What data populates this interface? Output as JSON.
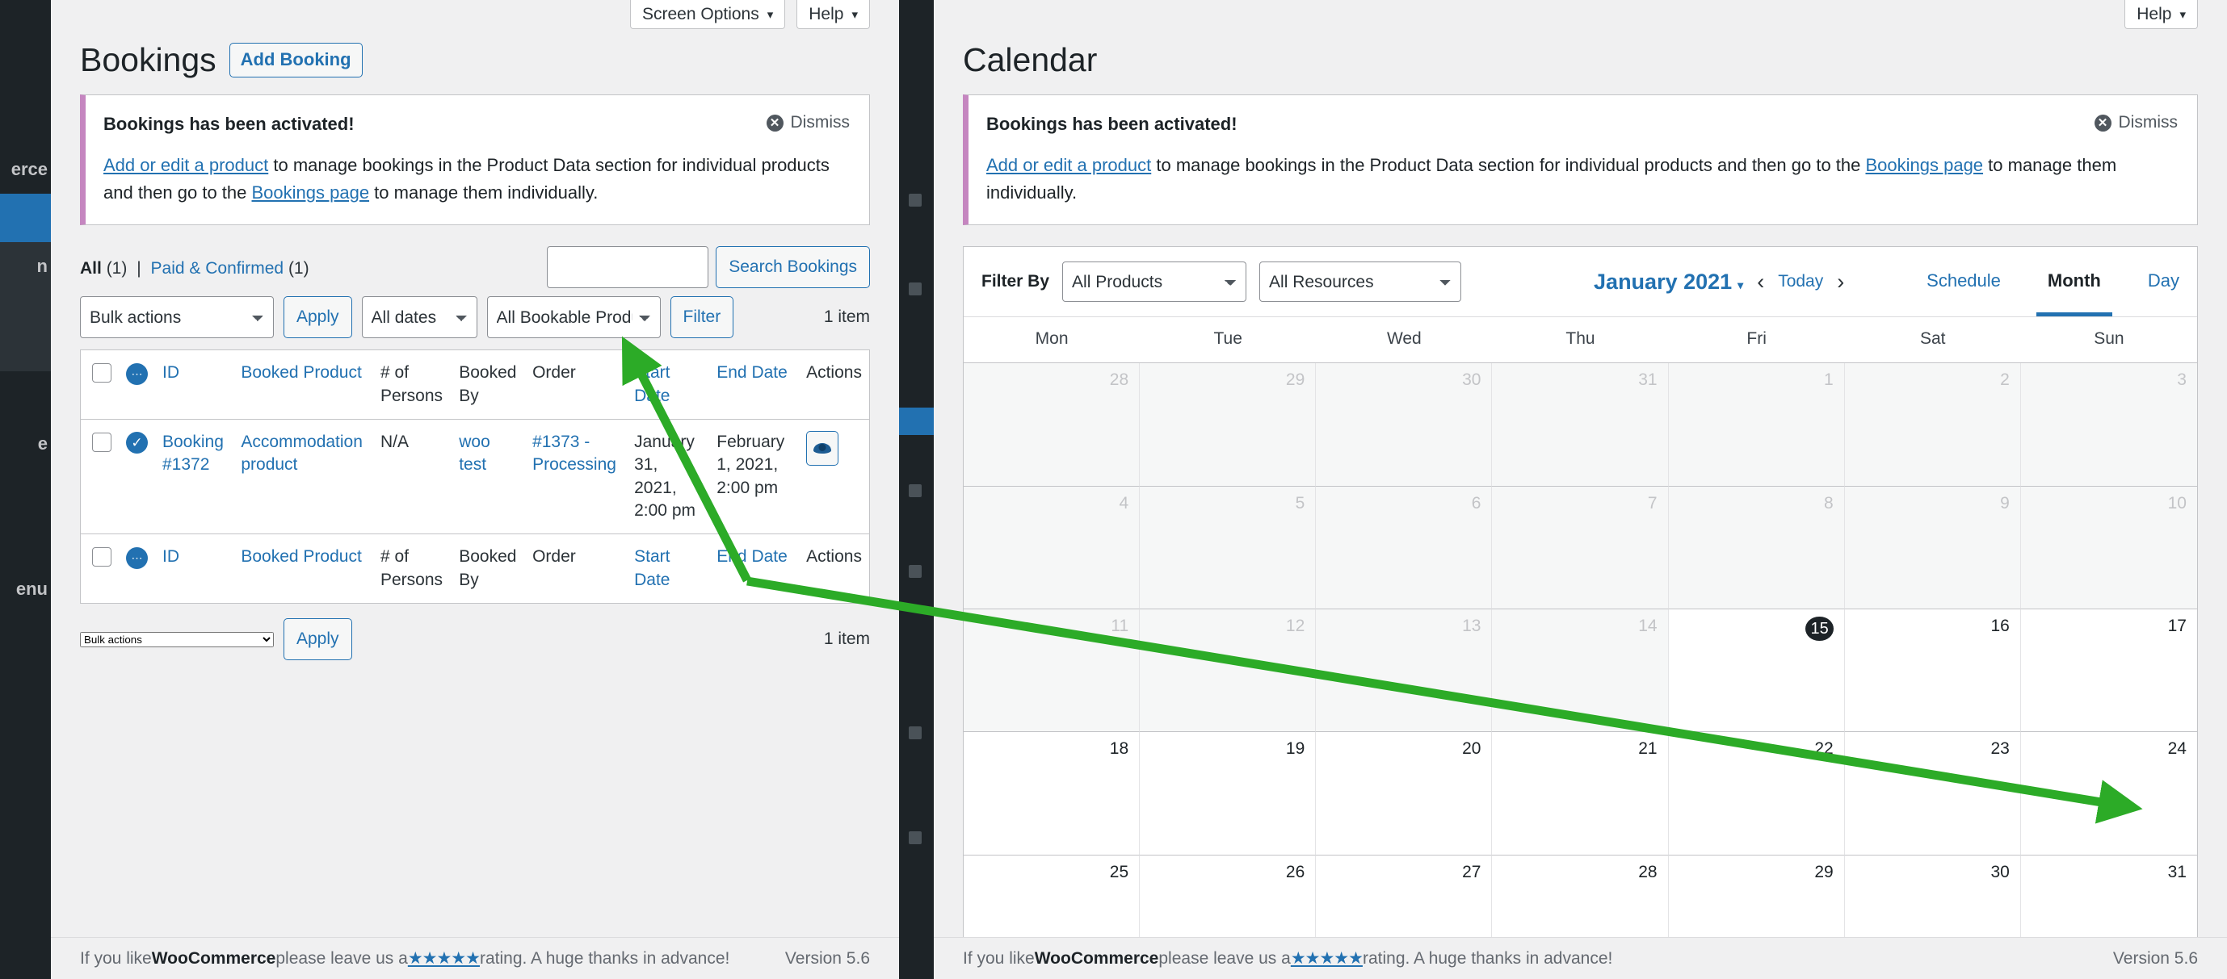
{
  "sidebar": {
    "items": [
      {
        "label": "erce",
        "state": "normal"
      },
      {
        "label": "",
        "state": "current"
      },
      {
        "label": "n",
        "state": "submenu"
      },
      {
        "label": "e",
        "state": "normal"
      },
      {
        "label": "enu",
        "state": "normal"
      }
    ]
  },
  "bookings_page": {
    "screen_meta": [
      {
        "label": "Screen Options",
        "caret": "▾"
      },
      {
        "label": "Help",
        "caret": "▾"
      }
    ],
    "title": "Bookings",
    "add_button": "Add Booking",
    "notice": {
      "title": "Bookings has been activated!",
      "link1": "Add or edit a product",
      "text_mid": " to manage bookings in the Product Data section for individual products and then go to the ",
      "link2": "Bookings page",
      "text_end": " to manage them individually.",
      "dismiss": "Dismiss",
      "accent_color": "#c586c0"
    },
    "views": {
      "all_label": "All",
      "all_count": "(1)",
      "separator": "|",
      "paid_label": "Paid & Confirmed",
      "paid_count": "(1)"
    },
    "search": {
      "value": "",
      "placeholder": "",
      "button": "Search Bookings"
    },
    "tablenav": {
      "bulk_actions": "Bulk actions",
      "apply": "Apply",
      "all_dates": "All dates",
      "all_products": "All Bookable Products",
      "filter": "Filter",
      "count": "1 item"
    },
    "table": {
      "columns": [
        "ID",
        "Booked Product",
        "# of Persons",
        "Booked By",
        "Order",
        "Start Date",
        "End Date",
        "Actions"
      ],
      "rows": [
        {
          "id": "Booking #1372",
          "product": "Accommodation product",
          "persons": "N/A",
          "booked_by": "woo test",
          "order": "#1373 - Processing",
          "start_date": "January 31, 2021, 2:00 pm",
          "end_date": "February 1, 2021, 2:00 pm",
          "status": "confirmed",
          "action_icon": "eye-icon"
        }
      ]
    },
    "bottomnav": {
      "bulk_actions": "Bulk actions",
      "apply": "Apply",
      "count": "1 item"
    },
    "footer": {
      "pre": "If you like ",
      "brand": "WooCommerce",
      "mid": " please leave us a ",
      "stars": "★★★★★",
      "post": " rating. A huge thanks in advance!",
      "version": "Version 5.6"
    }
  },
  "calendar_page": {
    "help_tab": {
      "label": "Help",
      "caret": "▾"
    },
    "title": "Calendar",
    "notice": {
      "title": "Bookings has been activated!",
      "link1": "Add or edit a product",
      "text_mid": " to manage bookings in the Product Data section for individual products and then go to the ",
      "link2": "Bookings page",
      "text_end": " to manage them individually.",
      "dismiss": "Dismiss",
      "accent_color": "#c586c0"
    },
    "toolbar": {
      "filter_by": "Filter By",
      "products_select": "All Products",
      "resources_select": "All Resources",
      "month_label": "January 2021",
      "month_caret": "▾",
      "prev": "‹",
      "today": "Today",
      "next": "›",
      "views": [
        {
          "label": "Schedule",
          "active": false
        },
        {
          "label": "Month",
          "active": true
        },
        {
          "label": "Day",
          "active": false
        }
      ]
    },
    "weekdays": [
      "Mon",
      "Tue",
      "Wed",
      "Thu",
      "Fri",
      "Sat",
      "Sun"
    ],
    "days": [
      {
        "n": "28",
        "type": "other"
      },
      {
        "n": "29",
        "type": "other"
      },
      {
        "n": "30",
        "type": "other"
      },
      {
        "n": "31",
        "type": "other"
      },
      {
        "n": "1",
        "type": "past"
      },
      {
        "n": "2",
        "type": "past"
      },
      {
        "n": "3",
        "type": "past"
      },
      {
        "n": "4",
        "type": "past"
      },
      {
        "n": "5",
        "type": "past"
      },
      {
        "n": "6",
        "type": "past"
      },
      {
        "n": "7",
        "type": "past"
      },
      {
        "n": "8",
        "type": "past"
      },
      {
        "n": "9",
        "type": "past"
      },
      {
        "n": "10",
        "type": "past"
      },
      {
        "n": "11",
        "type": "past"
      },
      {
        "n": "12",
        "type": "past"
      },
      {
        "n": "13",
        "type": "past"
      },
      {
        "n": "14",
        "type": "past"
      },
      {
        "n": "15",
        "type": "today"
      },
      {
        "n": "16",
        "type": "normal"
      },
      {
        "n": "17",
        "type": "normal"
      },
      {
        "n": "18",
        "type": "normal"
      },
      {
        "n": "19",
        "type": "normal"
      },
      {
        "n": "20",
        "type": "normal"
      },
      {
        "n": "21",
        "type": "normal"
      },
      {
        "n": "22",
        "type": "normal"
      },
      {
        "n": "23",
        "type": "normal"
      },
      {
        "n": "24",
        "type": "normal"
      },
      {
        "n": "25",
        "type": "normal"
      },
      {
        "n": "26",
        "type": "normal"
      },
      {
        "n": "27",
        "type": "normal"
      },
      {
        "n": "28",
        "type": "normal"
      },
      {
        "n": "29",
        "type": "normal"
      },
      {
        "n": "30",
        "type": "normal"
      },
      {
        "n": "31",
        "type": "normal"
      }
    ],
    "footer": {
      "pre": "If you like ",
      "brand": "WooCommerce",
      "mid": " please leave us a ",
      "stars": "★★★★★",
      "post": " rating. A huge thanks in advance!",
      "version": "Version 5.6"
    }
  },
  "annotation": {
    "arrow_color": "#2cab27",
    "from": "start-date-cell",
    "to": "calendar-day-31"
  }
}
